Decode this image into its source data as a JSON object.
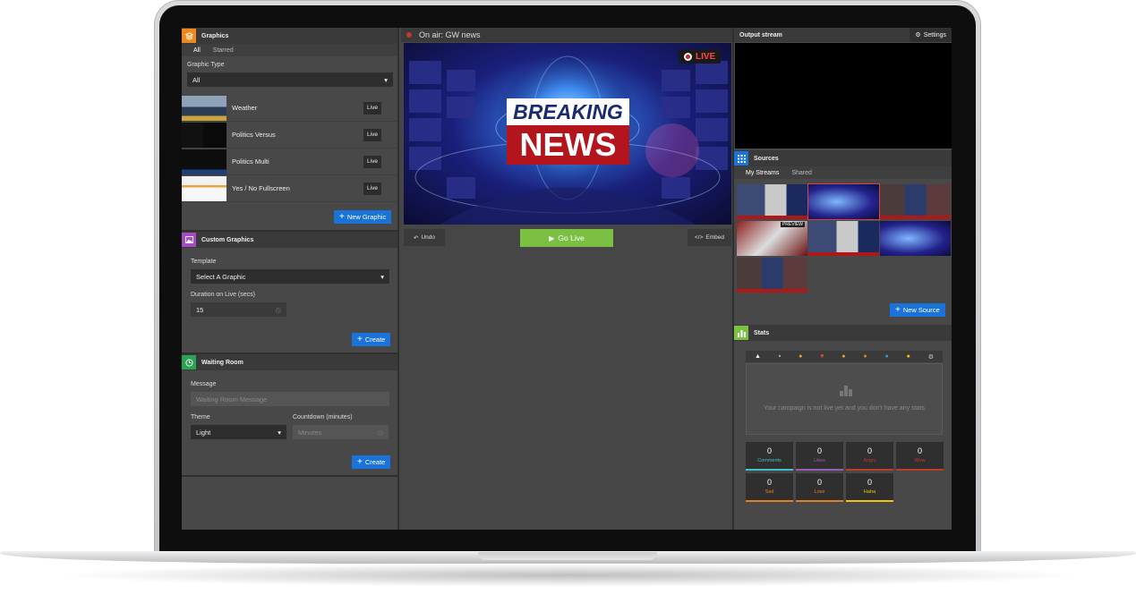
{
  "graphics": {
    "title": "Graphics",
    "tabs": [
      "All",
      "Starred"
    ],
    "type_label": "Graphic Type",
    "type_value": "All",
    "items": [
      {
        "name": "Weather",
        "action": "Live"
      },
      {
        "name": "Politics Versus",
        "action": "Live"
      },
      {
        "name": "Politics Multi",
        "action": "Live"
      },
      {
        "name": "Yes / No Fullscreen",
        "action": "Live"
      }
    ],
    "new_button": "New Graphic"
  },
  "custom_graphics": {
    "title": "Custom Graphics",
    "template_label": "Template",
    "template_value": "Select A Graphic",
    "duration_label": "Duration on Live (secs)",
    "duration_value": "15",
    "create_button": "Create"
  },
  "waiting_room": {
    "title": "Waiting Room",
    "message_label": "Message",
    "message_placeholder": "Waiting Room Message",
    "theme_label": "Theme",
    "theme_value": "Light",
    "countdown_label": "Countdown (minutes)",
    "countdown_placeholder": "Minutes",
    "create_button": "Create"
  },
  "on_air": {
    "label": "On air: GW news",
    "live_badge": "LIVE",
    "headline_line1": "BREAKING",
    "headline_line2": "NEWS",
    "undo_button": "Undo",
    "go_live_button": "Go Live",
    "embed_button": "Embed"
  },
  "output_stream": {
    "title": "Output stream",
    "settings_button": "Settings"
  },
  "sources": {
    "title": "Sources",
    "tabs": [
      "My Streams",
      "Shared"
    ],
    "preview_badge": "PREVIEW",
    "new_button": "New Source"
  },
  "stats": {
    "title": "Stats",
    "empty_message": "Your campaign is not live yet and you don't have any stats.",
    "cards": [
      {
        "label": "Comments",
        "value": "0",
        "color": "#3fc1c9"
      },
      {
        "label": "Likes",
        "value": "0",
        "color": "#9b59b6"
      },
      {
        "label": "Angry",
        "value": "0",
        "color": "#c0392b"
      },
      {
        "label": "Wow",
        "value": "0",
        "color": "#c0392b"
      },
      {
        "label": "Sad",
        "value": "0",
        "color": "#e67e22"
      },
      {
        "label": "Love",
        "value": "0",
        "color": "#e67e22"
      },
      {
        "label": "Haha",
        "value": "0",
        "color": "#f1c40f"
      }
    ]
  },
  "colors": {
    "accent_blue": "#1a73d9",
    "go_live_green": "#7cc043",
    "live_red": "#d61f1f"
  }
}
